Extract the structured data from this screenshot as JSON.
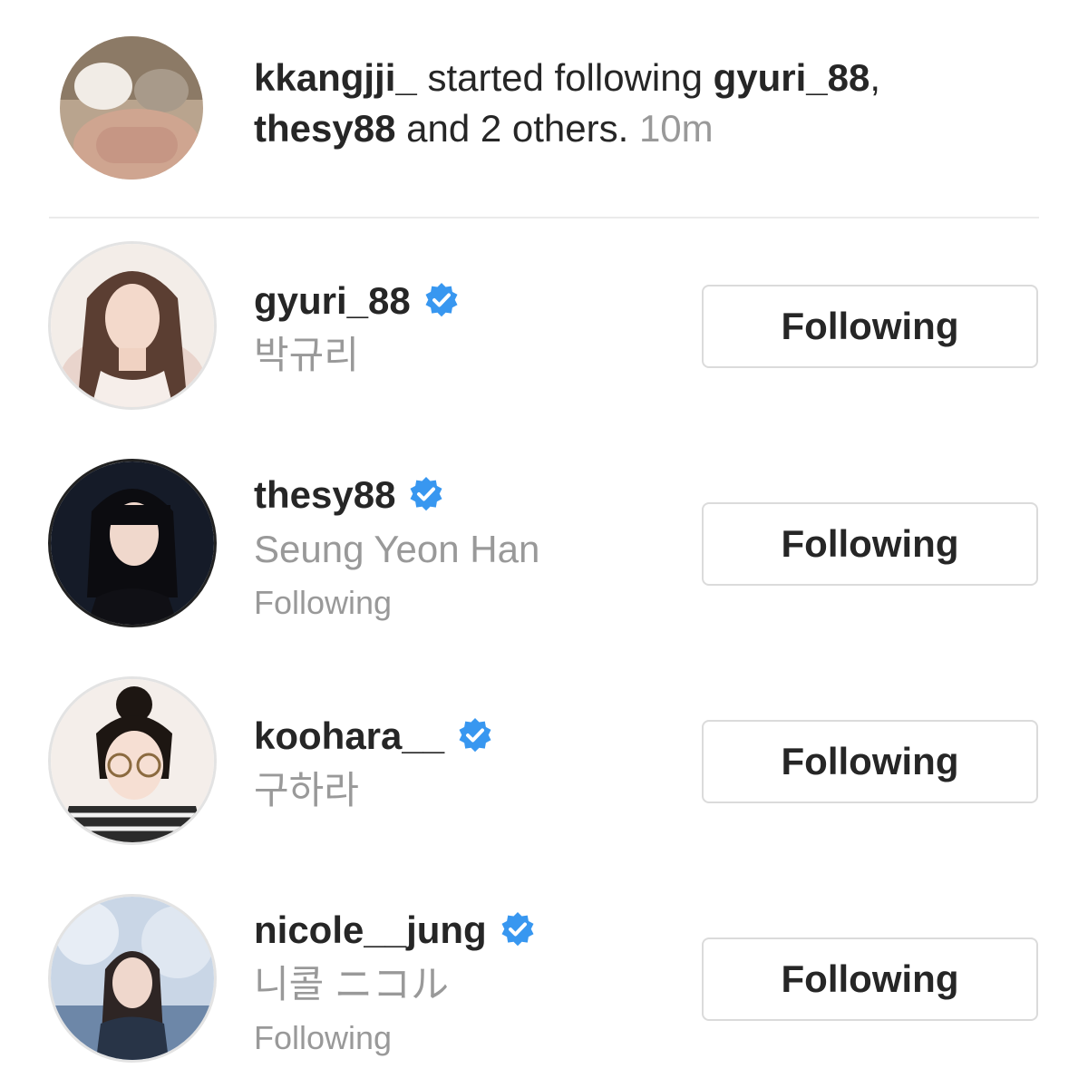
{
  "notification": {
    "actor": "kkangjji_",
    "action": "started following",
    "first_user": "gyuri_88",
    "comma": ",",
    "second_user": "thesy88",
    "others": "and 2 others.",
    "time": "10m"
  },
  "users": [
    {
      "username": "gyuri_88",
      "full_name": "박규리",
      "subtitle": "",
      "button_label": "Following",
      "verified_icon": "verified-badge"
    },
    {
      "username": "thesy88",
      "full_name": "Seung Yeon Han",
      "subtitle": "Following",
      "button_label": "Following",
      "verified_icon": "verified-badge"
    },
    {
      "username": "koohara__",
      "full_name": "구하라",
      "subtitle": "",
      "button_label": "Following",
      "verified_icon": "verified-badge"
    },
    {
      "username": "nicole__jung",
      "full_name": "니콜 ニコル",
      "subtitle": "Following",
      "button_label": "Following",
      "verified_icon": "verified-badge"
    }
  ],
  "colors": {
    "verified_blue": "#3897f0",
    "secondary_text": "#999999",
    "primary_text": "#262626",
    "button_border": "#dbdbdb"
  }
}
